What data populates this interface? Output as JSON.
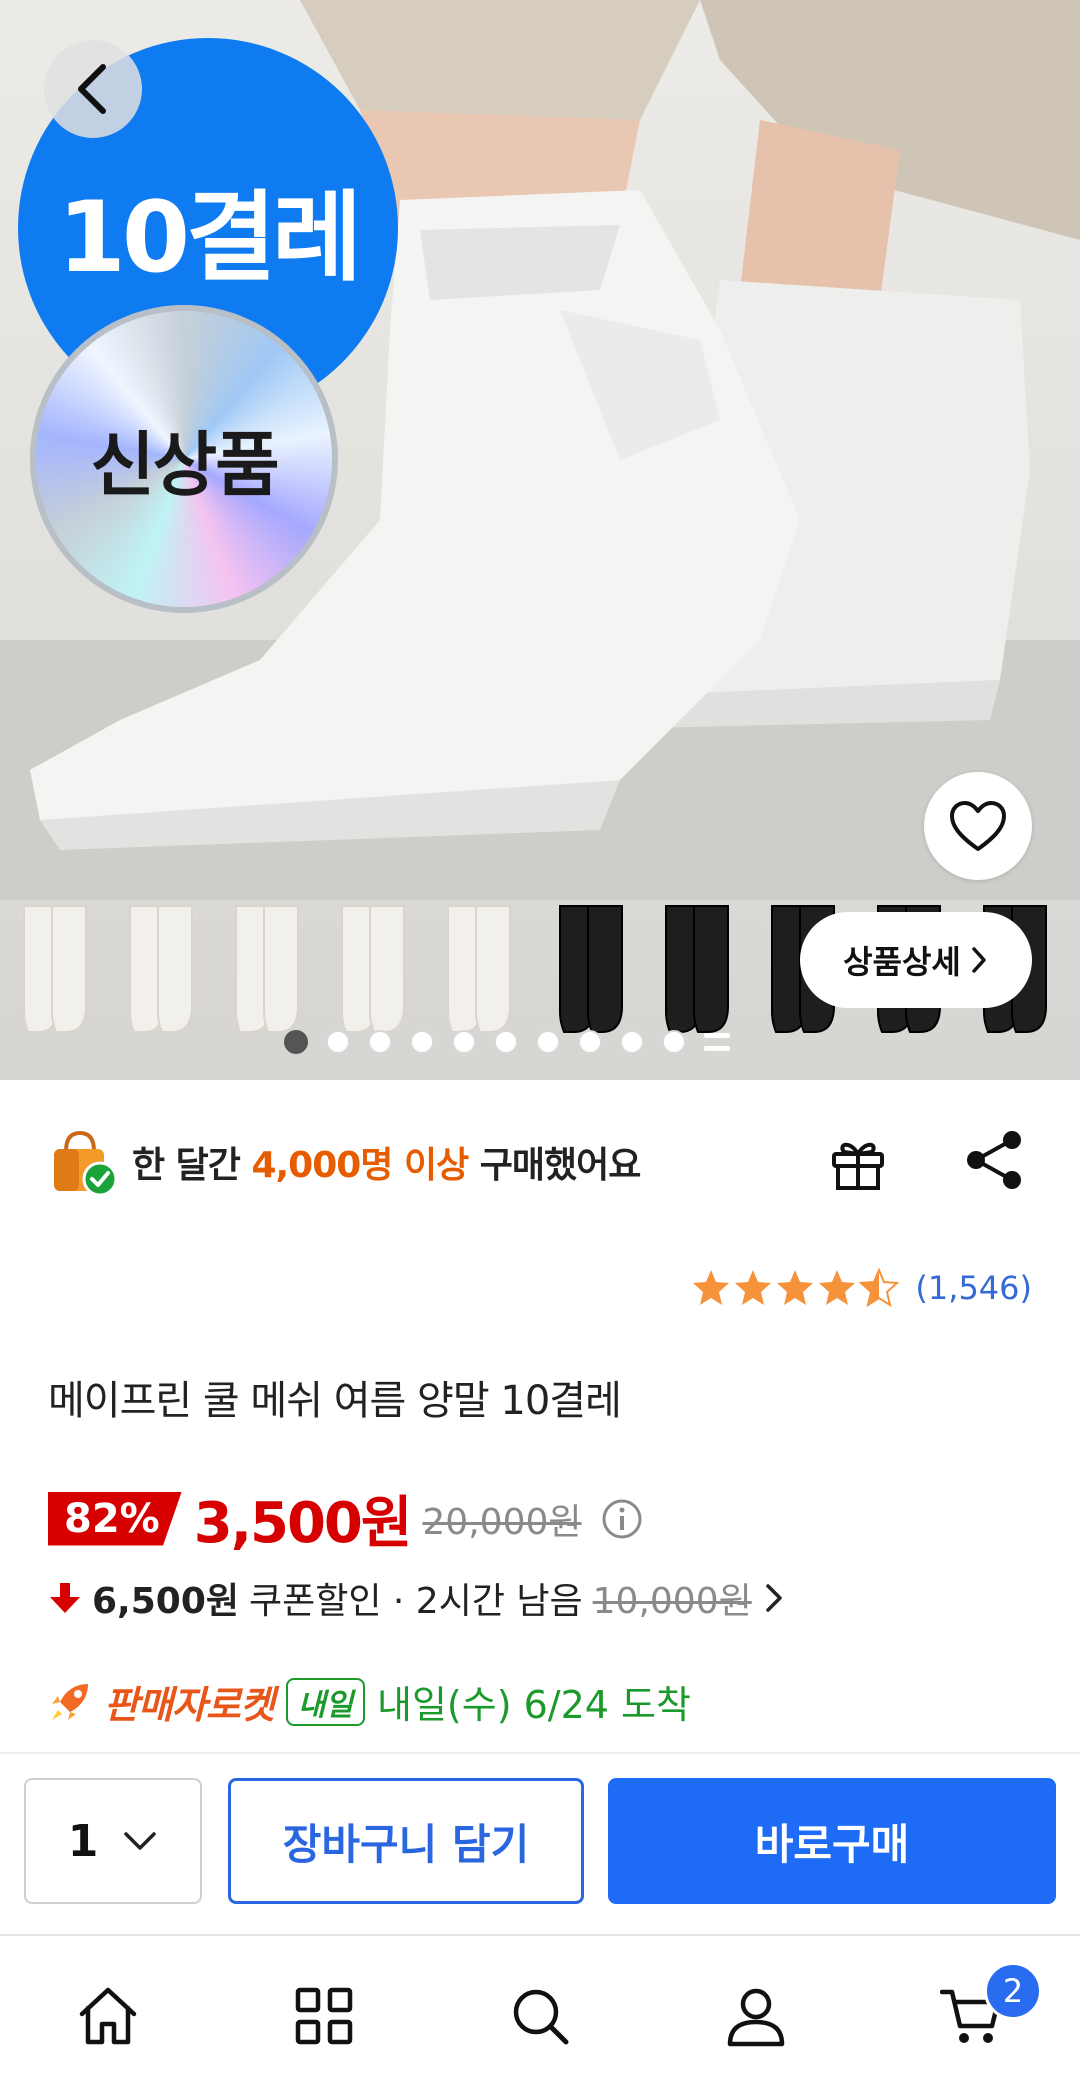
{
  "hero": {
    "badge_count": "10결레",
    "badge_new": "신상품",
    "detail_button": "상품상세",
    "image_count": 11,
    "current_image": 1
  },
  "purchase_info": {
    "prefix": "한 달간 ",
    "highlight": "4,000명 이상",
    "suffix": " 구매했어요"
  },
  "rating": {
    "stars": 4.5,
    "count": "(1,546)"
  },
  "product": {
    "title": "메이프린 쿨 메쉬 여름 양말 10결레"
  },
  "price": {
    "discount": "82%",
    "sale": "3,500원",
    "original": "20,000원"
  },
  "coupon": {
    "amount": "6,500원",
    "label": "쿠폰할인 · 2시간 남음",
    "original": "10,000원"
  },
  "delivery": {
    "brand": "판매자로켓",
    "badge": "내일",
    "text": "내일(수) 6/24 도착"
  },
  "buy_bar": {
    "quantity": "1",
    "cart_label": "장바구니 담기",
    "buy_label": "바로구매"
  },
  "bottom_nav": {
    "cart_count": "2"
  },
  "colors": {
    "accent_blue": "#1e6bf5",
    "sale_red": "#d60000",
    "highlight_orange": "#e65c00",
    "delivery_green": "#1b9a2b"
  }
}
